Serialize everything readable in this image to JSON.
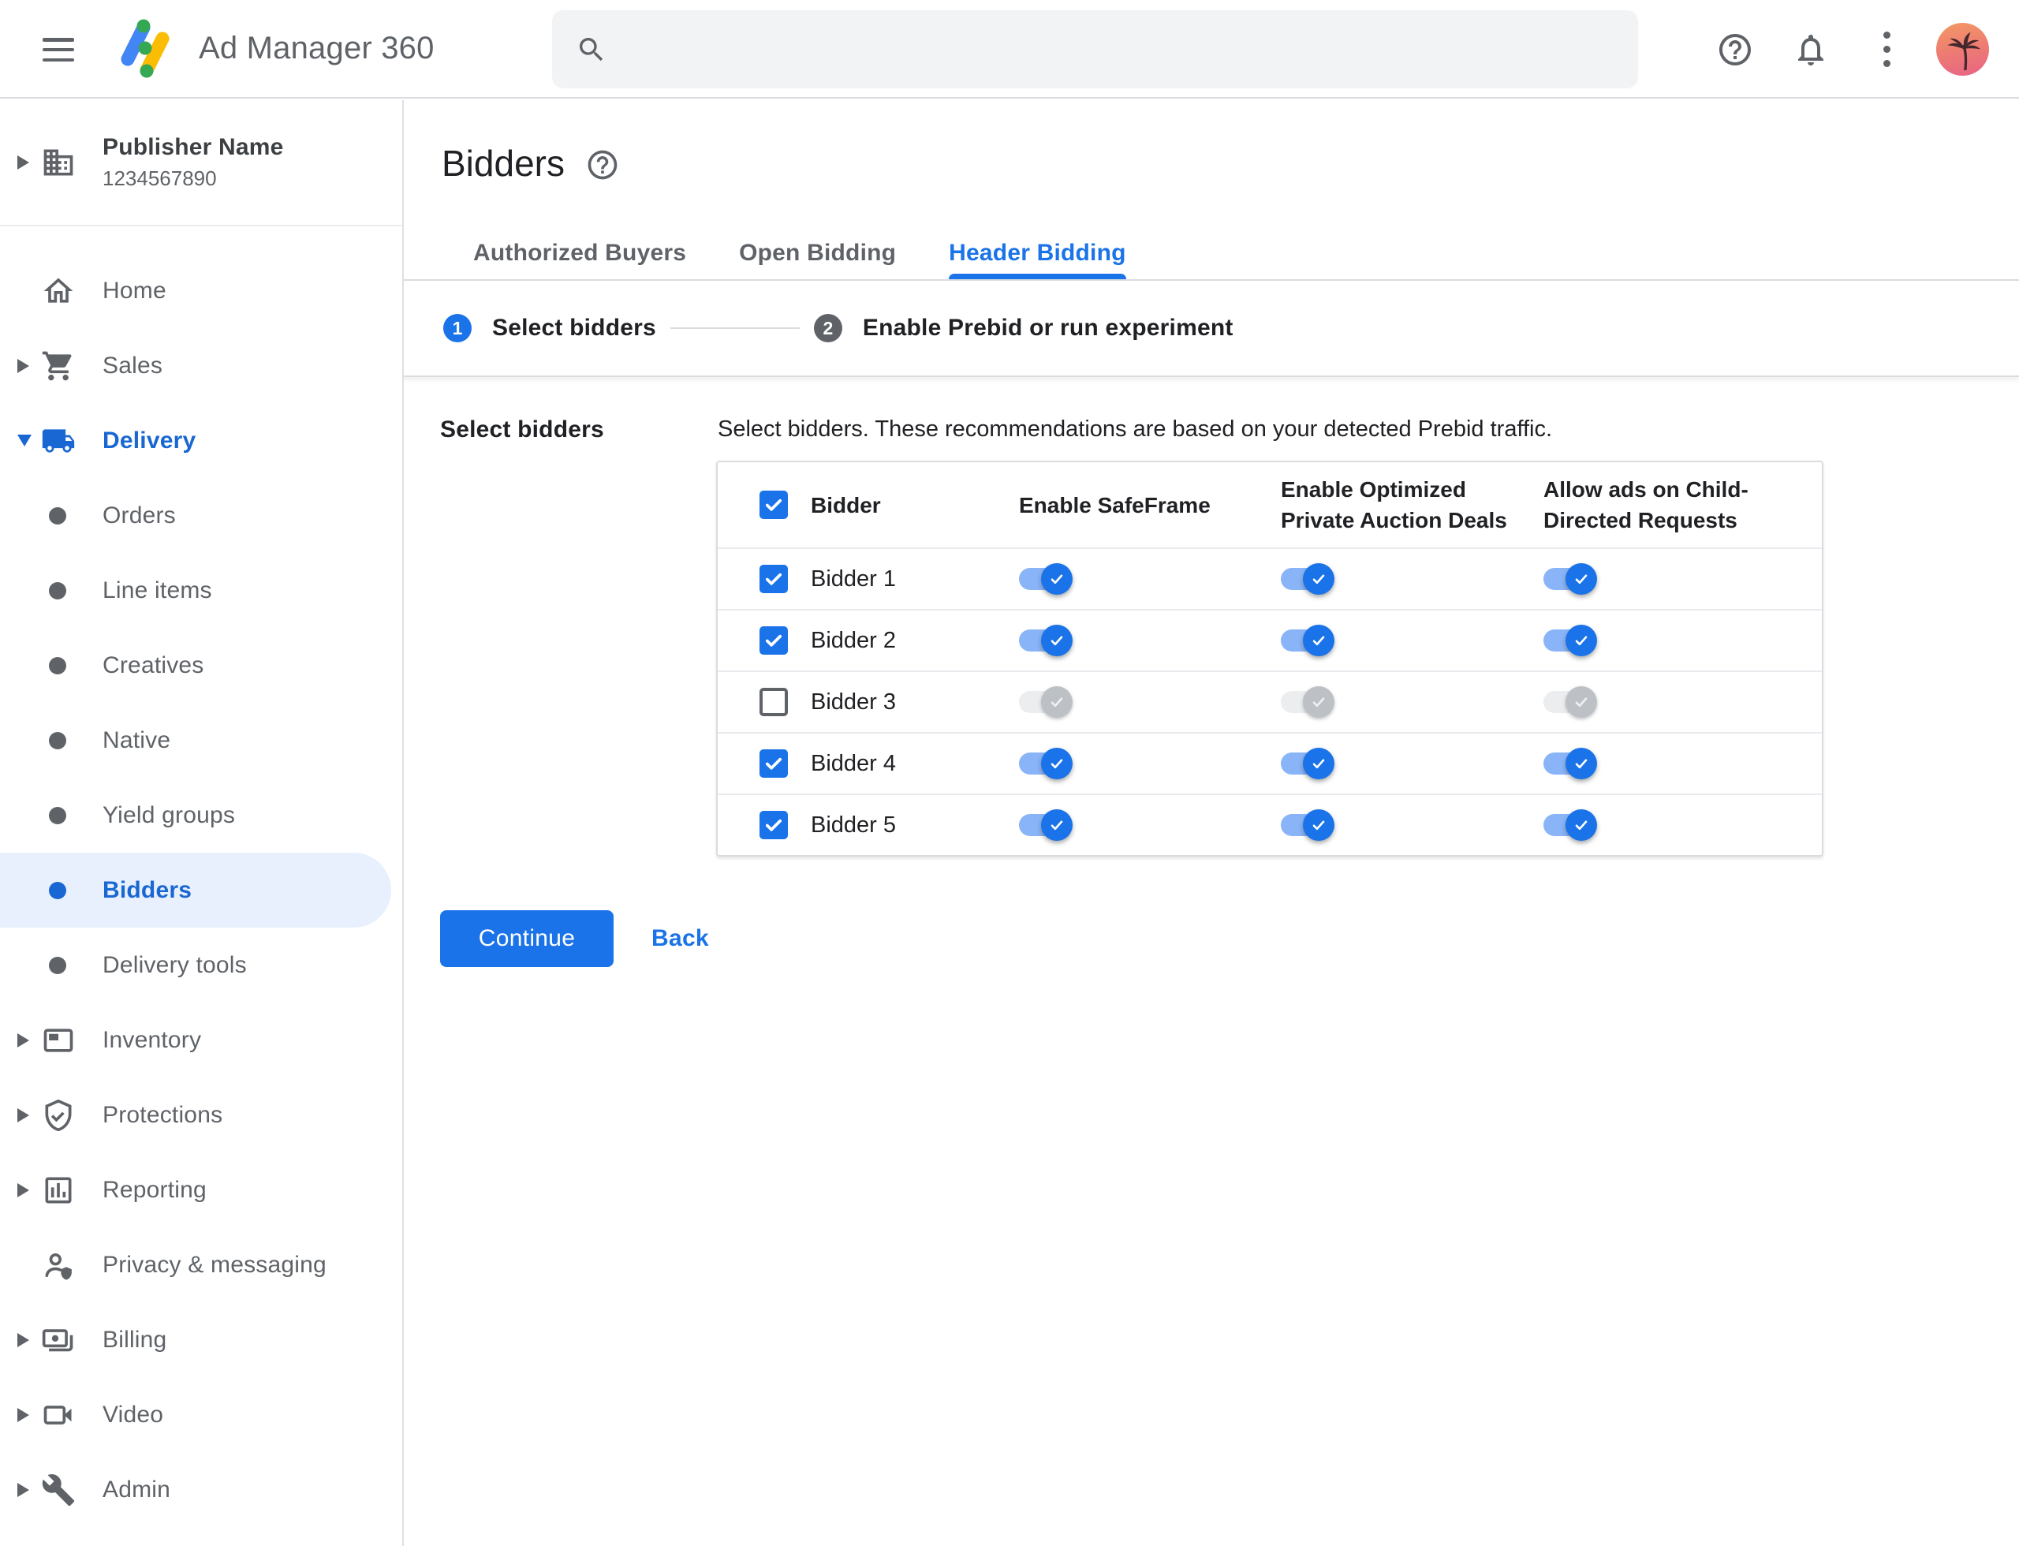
{
  "header": {
    "product_name": "Ad Manager 360",
    "search": {
      "value": "",
      "placeholder": ""
    }
  },
  "sidebar": {
    "publisher": {
      "name": "Publisher Name",
      "id": "1234567890"
    },
    "nav": [
      {
        "label": "Home",
        "icon": "home",
        "type": "item",
        "expandable": false
      },
      {
        "label": "Sales",
        "icon": "cart",
        "type": "item",
        "expandable": true
      },
      {
        "label": "Delivery",
        "icon": "truck",
        "type": "item",
        "expandable": true,
        "expanded": true,
        "active": true
      },
      {
        "label": "Orders",
        "type": "sub"
      },
      {
        "label": "Line items",
        "type": "sub"
      },
      {
        "label": "Creatives",
        "type": "sub"
      },
      {
        "label": "Native",
        "type": "sub"
      },
      {
        "label": "Yield groups",
        "type": "sub"
      },
      {
        "label": "Bidders",
        "type": "sub",
        "selected": true
      },
      {
        "label": "Delivery tools",
        "type": "sub"
      },
      {
        "label": "Inventory",
        "icon": "inventory",
        "type": "item",
        "expandable": true
      },
      {
        "label": "Protections",
        "icon": "shield",
        "type": "item",
        "expandable": true
      },
      {
        "label": "Reporting",
        "icon": "report",
        "type": "item",
        "expandable": true
      },
      {
        "label": "Privacy & messaging",
        "icon": "privacy",
        "type": "item",
        "expandable": false
      },
      {
        "label": "Billing",
        "icon": "billing",
        "type": "item",
        "expandable": true
      },
      {
        "label": "Video",
        "icon": "video",
        "type": "item",
        "expandable": true
      },
      {
        "label": "Admin",
        "icon": "admin",
        "type": "item",
        "expandable": true
      }
    ]
  },
  "page": {
    "title": "Bidders",
    "tabs": [
      {
        "label": "Authorized Buyers",
        "active": false
      },
      {
        "label": "Open Bidding",
        "active": false
      },
      {
        "label": "Header Bidding",
        "active": true
      }
    ],
    "stepper": [
      {
        "number": "1",
        "label": "Select bidders",
        "state": "active"
      },
      {
        "number": "2",
        "label": "Enable Prebid or run experiment",
        "state": "upcoming"
      }
    ],
    "section_label": "Select bidders",
    "description": "Select bidders. These recommendations are based on your detected Prebid traffic.",
    "table": {
      "select_all_checked": true,
      "columns": [
        "Bidder",
        "Enable SafeFrame",
        "Enable Optimized Private Auction Deals",
        "Allow ads on Child-Directed Requests"
      ],
      "rows": [
        {
          "name": "Bidder 1",
          "selected": true,
          "enable_safeframe": true,
          "enable_optimized_private_auction_deals": true,
          "allow_ads_child_directed": true
        },
        {
          "name": "Bidder 2",
          "selected": true,
          "enable_safeframe": true,
          "enable_optimized_private_auction_deals": true,
          "allow_ads_child_directed": true
        },
        {
          "name": "Bidder 3",
          "selected": false,
          "enable_safeframe": false,
          "enable_optimized_private_auction_deals": false,
          "allow_ads_child_directed": false
        },
        {
          "name": "Bidder 4",
          "selected": true,
          "enable_safeframe": true,
          "enable_optimized_private_auction_deals": true,
          "allow_ads_child_directed": true
        },
        {
          "name": "Bidder 5",
          "selected": true,
          "enable_safeframe": true,
          "enable_optimized_private_auction_deals": true,
          "allow_ads_child_directed": true
        }
      ]
    },
    "actions": {
      "continue_label": "Continue",
      "back_label": "Back"
    }
  },
  "colors": {
    "accent": "#1a73e8",
    "accent_nav": "#1967d2",
    "selected_pill": "#e8f0fe",
    "toggle_track_on": "#8ab4f8",
    "toggle_thumb_on": "#1a73e8",
    "toggle_track_off": "#ebedef",
    "toggle_thumb_off": "#bdc1c6",
    "text_primary": "#202124",
    "text_secondary": "#5f6368",
    "border": "#dadce0"
  }
}
